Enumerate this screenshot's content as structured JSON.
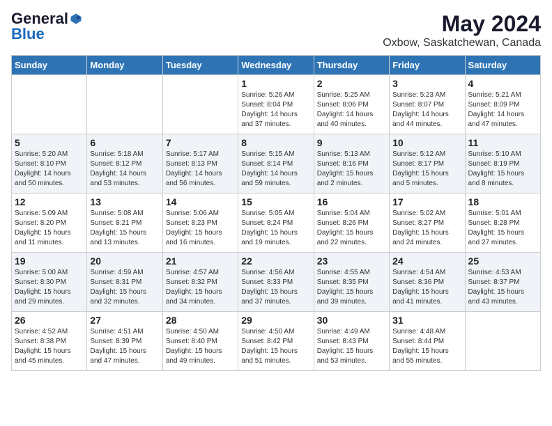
{
  "header": {
    "logo_general": "General",
    "logo_blue": "Blue",
    "title": "May 2024",
    "subtitle": "Oxbow, Saskatchewan, Canada"
  },
  "calendar": {
    "days_of_week": [
      "Sunday",
      "Monday",
      "Tuesday",
      "Wednesday",
      "Thursday",
      "Friday",
      "Saturday"
    ],
    "weeks": [
      [
        {
          "day": "",
          "info": ""
        },
        {
          "day": "",
          "info": ""
        },
        {
          "day": "",
          "info": ""
        },
        {
          "day": "1",
          "info": "Sunrise: 5:26 AM\nSunset: 8:04 PM\nDaylight: 14 hours\nand 37 minutes."
        },
        {
          "day": "2",
          "info": "Sunrise: 5:25 AM\nSunset: 8:06 PM\nDaylight: 14 hours\nand 40 minutes."
        },
        {
          "day": "3",
          "info": "Sunrise: 5:23 AM\nSunset: 8:07 PM\nDaylight: 14 hours\nand 44 minutes."
        },
        {
          "day": "4",
          "info": "Sunrise: 5:21 AM\nSunset: 8:09 PM\nDaylight: 14 hours\nand 47 minutes."
        }
      ],
      [
        {
          "day": "5",
          "info": "Sunrise: 5:20 AM\nSunset: 8:10 PM\nDaylight: 14 hours\nand 50 minutes."
        },
        {
          "day": "6",
          "info": "Sunrise: 5:18 AM\nSunset: 8:12 PM\nDaylight: 14 hours\nand 53 minutes."
        },
        {
          "day": "7",
          "info": "Sunrise: 5:17 AM\nSunset: 8:13 PM\nDaylight: 14 hours\nand 56 minutes."
        },
        {
          "day": "8",
          "info": "Sunrise: 5:15 AM\nSunset: 8:14 PM\nDaylight: 14 hours\nand 59 minutes."
        },
        {
          "day": "9",
          "info": "Sunrise: 5:13 AM\nSunset: 8:16 PM\nDaylight: 15 hours\nand 2 minutes."
        },
        {
          "day": "10",
          "info": "Sunrise: 5:12 AM\nSunset: 8:17 PM\nDaylight: 15 hours\nand 5 minutes."
        },
        {
          "day": "11",
          "info": "Sunrise: 5:10 AM\nSunset: 8:19 PM\nDaylight: 15 hours\nand 8 minutes."
        }
      ],
      [
        {
          "day": "12",
          "info": "Sunrise: 5:09 AM\nSunset: 8:20 PM\nDaylight: 15 hours\nand 11 minutes."
        },
        {
          "day": "13",
          "info": "Sunrise: 5:08 AM\nSunset: 8:21 PM\nDaylight: 15 hours\nand 13 minutes."
        },
        {
          "day": "14",
          "info": "Sunrise: 5:06 AM\nSunset: 8:23 PM\nDaylight: 15 hours\nand 16 minutes."
        },
        {
          "day": "15",
          "info": "Sunrise: 5:05 AM\nSunset: 8:24 PM\nDaylight: 15 hours\nand 19 minutes."
        },
        {
          "day": "16",
          "info": "Sunrise: 5:04 AM\nSunset: 8:26 PM\nDaylight: 15 hours\nand 22 minutes."
        },
        {
          "day": "17",
          "info": "Sunrise: 5:02 AM\nSunset: 8:27 PM\nDaylight: 15 hours\nand 24 minutes."
        },
        {
          "day": "18",
          "info": "Sunrise: 5:01 AM\nSunset: 8:28 PM\nDaylight: 15 hours\nand 27 minutes."
        }
      ],
      [
        {
          "day": "19",
          "info": "Sunrise: 5:00 AM\nSunset: 8:30 PM\nDaylight: 15 hours\nand 29 minutes."
        },
        {
          "day": "20",
          "info": "Sunrise: 4:59 AM\nSunset: 8:31 PM\nDaylight: 15 hours\nand 32 minutes."
        },
        {
          "day": "21",
          "info": "Sunrise: 4:57 AM\nSunset: 8:32 PM\nDaylight: 15 hours\nand 34 minutes."
        },
        {
          "day": "22",
          "info": "Sunrise: 4:56 AM\nSunset: 8:33 PM\nDaylight: 15 hours\nand 37 minutes."
        },
        {
          "day": "23",
          "info": "Sunrise: 4:55 AM\nSunset: 8:35 PM\nDaylight: 15 hours\nand 39 minutes."
        },
        {
          "day": "24",
          "info": "Sunrise: 4:54 AM\nSunset: 8:36 PM\nDaylight: 15 hours\nand 41 minutes."
        },
        {
          "day": "25",
          "info": "Sunrise: 4:53 AM\nSunset: 8:37 PM\nDaylight: 15 hours\nand 43 minutes."
        }
      ],
      [
        {
          "day": "26",
          "info": "Sunrise: 4:52 AM\nSunset: 8:38 PM\nDaylight: 15 hours\nand 45 minutes."
        },
        {
          "day": "27",
          "info": "Sunrise: 4:51 AM\nSunset: 8:39 PM\nDaylight: 15 hours\nand 47 minutes."
        },
        {
          "day": "28",
          "info": "Sunrise: 4:50 AM\nSunset: 8:40 PM\nDaylight: 15 hours\nand 49 minutes."
        },
        {
          "day": "29",
          "info": "Sunrise: 4:50 AM\nSunset: 8:42 PM\nDaylight: 15 hours\nand 51 minutes."
        },
        {
          "day": "30",
          "info": "Sunrise: 4:49 AM\nSunset: 8:43 PM\nDaylight: 15 hours\nand 53 minutes."
        },
        {
          "day": "31",
          "info": "Sunrise: 4:48 AM\nSunset: 8:44 PM\nDaylight: 15 hours\nand 55 minutes."
        },
        {
          "day": "",
          "info": ""
        }
      ]
    ]
  }
}
